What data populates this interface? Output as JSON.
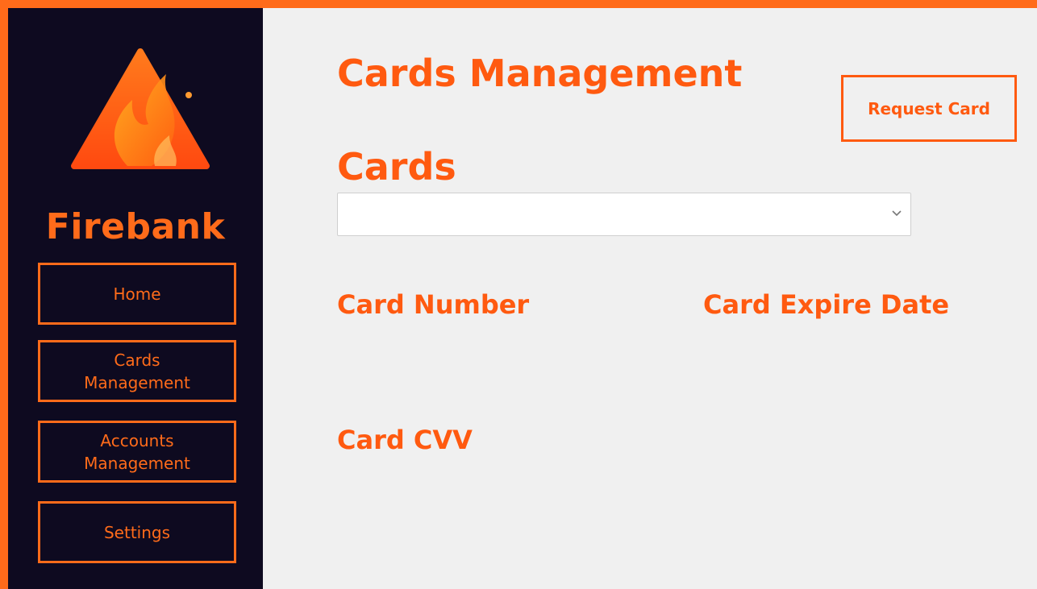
{
  "brand": {
    "name": "Firebank",
    "logo_icon": "flame-triangle-icon"
  },
  "nav": {
    "items": [
      {
        "label_line1": "Home",
        "label_line2": ""
      },
      {
        "label_line1": "Cards",
        "label_line2": "Management"
      },
      {
        "label_line1": "Accounts",
        "label_line2": "Management"
      },
      {
        "label_line1": "Settings",
        "label_line2": ""
      }
    ]
  },
  "main": {
    "title": "Cards Management",
    "request_button": "Request Card",
    "cards_section_title": "Cards",
    "cards_select_value": "",
    "fields": {
      "card_number": "Card Number",
      "card_expire_date": "Card Expire Date",
      "card_cvv": "Card CVV"
    }
  },
  "colors": {
    "accent": "#ff6b1a",
    "sidebar_bg": "#0e0a20",
    "content_bg": "#f0f0f0"
  }
}
